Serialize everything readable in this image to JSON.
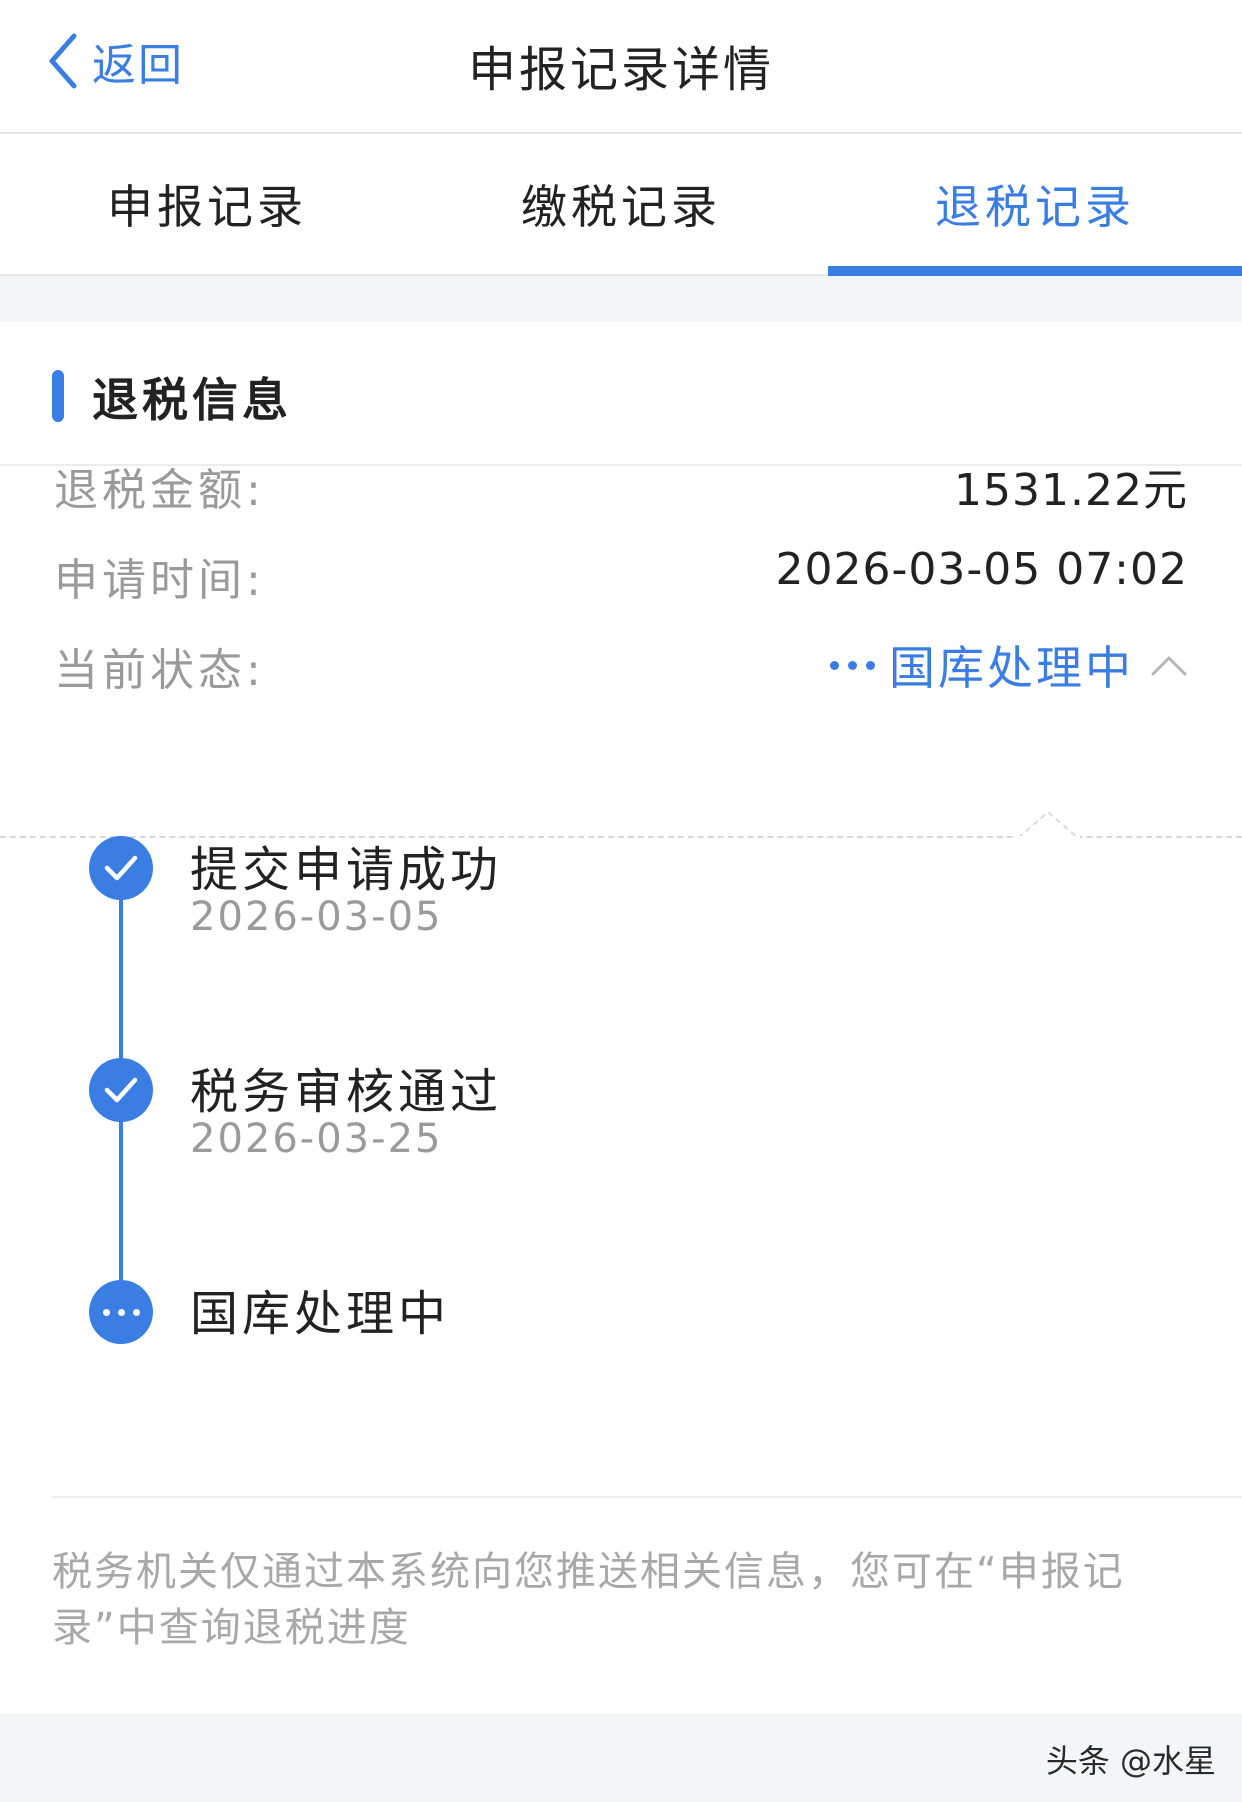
{
  "navbar": {
    "back_label": "返回",
    "title": "申报记录详情"
  },
  "tabs": [
    {
      "label": "申报记录",
      "active": false
    },
    {
      "label": "缴税记录",
      "active": false
    },
    {
      "label": "退税记录",
      "active": true
    }
  ],
  "refund_info": {
    "section_title": "退税信息",
    "amount_label": "退税金额:",
    "amount_value": "1531.22元",
    "time_label": "申请时间:",
    "time_value": "2026-03-05 07:02",
    "status_label": "当前状态:",
    "status_value": "国库处理中"
  },
  "timeline": [
    {
      "title": "提交申请成功",
      "date": "2026-03-05",
      "state": "done"
    },
    {
      "title": "税务审核通过",
      "date": "2026-03-25",
      "state": "done"
    },
    {
      "title": "国库处理中",
      "date": "",
      "state": "in-progress"
    }
  ],
  "note": "税务机关仅通过本系统向您推送相关信息，您可在“申报记录”中查询退税进度",
  "watermark": "头条 @水星",
  "colors": {
    "accent": "#3a7ee4",
    "muted_text": "#9a9a9a",
    "page_background": "#f4f5f7"
  },
  "icons": {
    "back": "chevron-left-icon",
    "status_toggle": "chevron-up-icon",
    "done": "check-icon",
    "in_progress": "ellipsis-icon"
  }
}
